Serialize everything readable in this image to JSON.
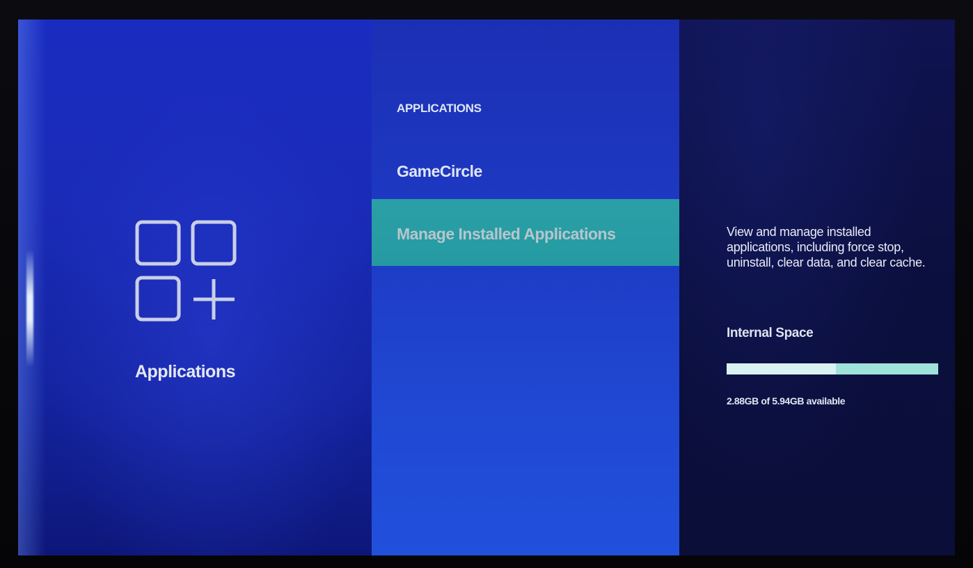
{
  "category": {
    "label": "Applications",
    "icon": "apps-grid-add-icon"
  },
  "menu": {
    "header": "APPLICATIONS",
    "items": [
      {
        "label": "GameCircle",
        "selected": false
      },
      {
        "label": "Manage Installed Applications",
        "selected": true
      }
    ]
  },
  "details": {
    "description": "View and manage installed applications, including force stop, uninstall, clear data, and clear cache.",
    "storage": {
      "title": "Internal Space",
      "used_fraction": 0.515,
      "summary": "2.88GB of 5.94GB available"
    }
  },
  "colors": {
    "selection_highlight": "#2aa0a6",
    "storage_bar_track": "#9fe2dc",
    "storage_bar_fill": "#d9f2f2"
  }
}
